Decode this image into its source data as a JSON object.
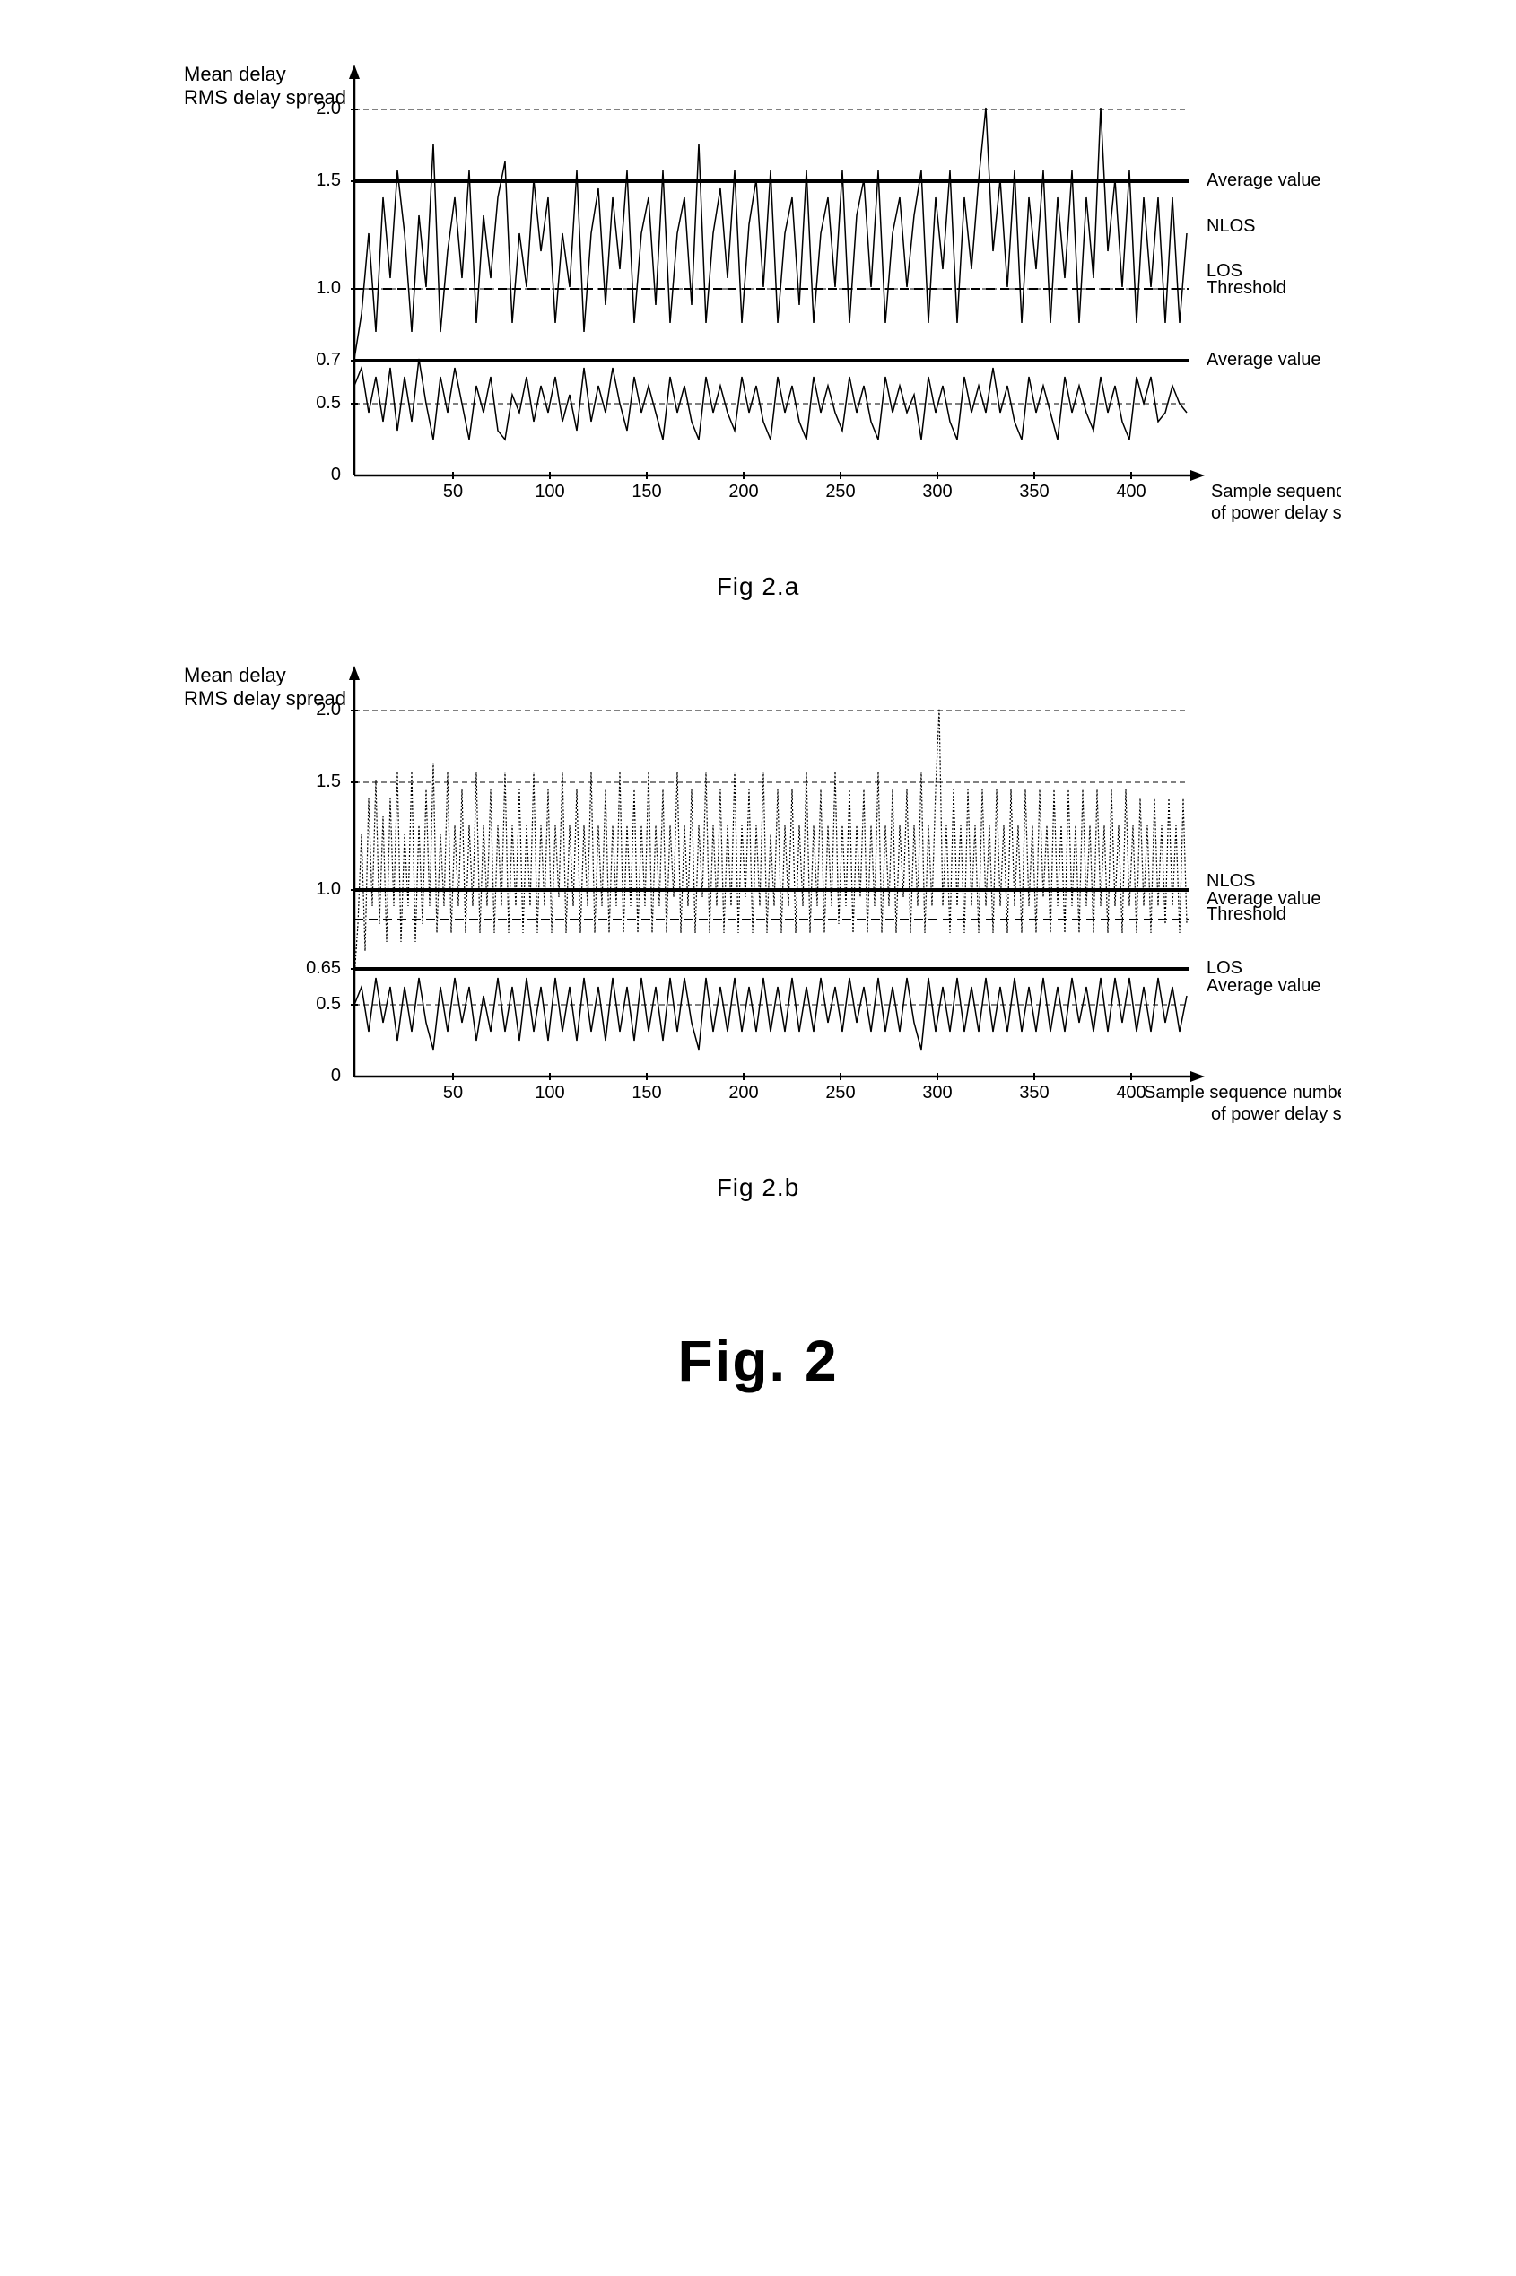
{
  "page": {
    "title": "Fig. 2",
    "background": "#ffffff"
  },
  "chart_a": {
    "y_label_line1": "Mean delay",
    "y_label_line2": "RMS delay spread",
    "y_axis_values": [
      "2.0",
      "1.5",
      "1.0",
      "0.7",
      "0.5",
      "0"
    ],
    "x_axis_values": [
      "50",
      "100",
      "150",
      "200",
      "250",
      "300",
      "350",
      "400"
    ],
    "x_axis_label_line1": "Sample sequence number",
    "x_axis_label_line2": "of power delay spread",
    "annotations": {
      "nlos": "NLOS",
      "los": "LOS",
      "threshold": "Threshold",
      "average_top": "Average value",
      "average_bottom": "Average value"
    },
    "caption": "Fig 2.a"
  },
  "chart_b": {
    "y_label_line1": "Mean delay",
    "y_label_line2": "RMS delay spread",
    "y_axis_values": [
      "2.0",
      "1.5",
      "1.0",
      "0.65",
      "0.5",
      "0"
    ],
    "x_axis_values": [
      "50",
      "100",
      "150",
      "200",
      "250",
      "300",
      "350",
      "400"
    ],
    "x_axis_label_line1": "Sample sequence number",
    "x_axis_label_line2": "of power delay spread",
    "annotations": {
      "nlos": "NLOS",
      "los": "LOS",
      "threshold": "Threshold",
      "average_top": "Average value",
      "average_bottom": "Average value"
    },
    "caption": "Fig 2.b"
  },
  "main_caption": "Fig. 2"
}
